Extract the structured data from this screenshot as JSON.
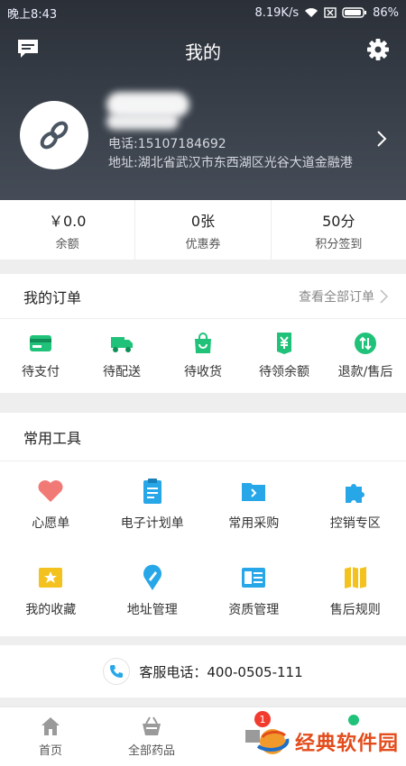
{
  "status_bar": {
    "time": "晚上8:43",
    "speed": "8.19K/s",
    "battery": "86%"
  },
  "header": {
    "title": "我的"
  },
  "profile": {
    "phone": "电话:15107184692",
    "address": "地址:湖北省武汉市东西湖区光谷大道金融港"
  },
  "stats": [
    {
      "value": "￥0.0",
      "label": "余额"
    },
    {
      "value": "0张",
      "label": "优惠券"
    },
    {
      "value": "50分",
      "label": "积分签到"
    }
  ],
  "orders": {
    "title": "我的订单",
    "view_all": "查看全部订单",
    "items": [
      {
        "label": "待支付",
        "icon": "card-icon"
      },
      {
        "label": "待配送",
        "icon": "truck-icon"
      },
      {
        "label": "待收货",
        "icon": "bag-icon"
      },
      {
        "label": "待领余额",
        "icon": "yen-icon"
      },
      {
        "label": "退款/售后",
        "icon": "refund-icon"
      }
    ]
  },
  "tools": {
    "title": "常用工具",
    "items": [
      {
        "label": "心愿单",
        "icon": "heart-icon"
      },
      {
        "label": "电子计划单",
        "icon": "clipboard-icon"
      },
      {
        "label": "常用采购",
        "icon": "folder-icon"
      },
      {
        "label": "控销专区",
        "icon": "puzzle-icon"
      },
      {
        "label": "我的收藏",
        "icon": "star-icon"
      },
      {
        "label": "地址管理",
        "icon": "location-icon"
      },
      {
        "label": "资质管理",
        "icon": "document-icon"
      },
      {
        "label": "售后规则",
        "icon": "map-icon"
      }
    ]
  },
  "service": {
    "text": "客服电话：400-0505-111"
  },
  "bottom_nav": {
    "items": [
      {
        "label": "首页",
        "icon": "home-icon"
      },
      {
        "label": "全部药品",
        "icon": "basket-icon"
      }
    ],
    "badge": "1"
  },
  "watermark": {
    "text": "经典软件园"
  },
  "colors": {
    "header": "#343a43",
    "accent_green": "#20c27a",
    "accent_blue": "#27a7e8",
    "accent_yellow": "#f3c21e",
    "accent_red": "#f26f6f"
  }
}
